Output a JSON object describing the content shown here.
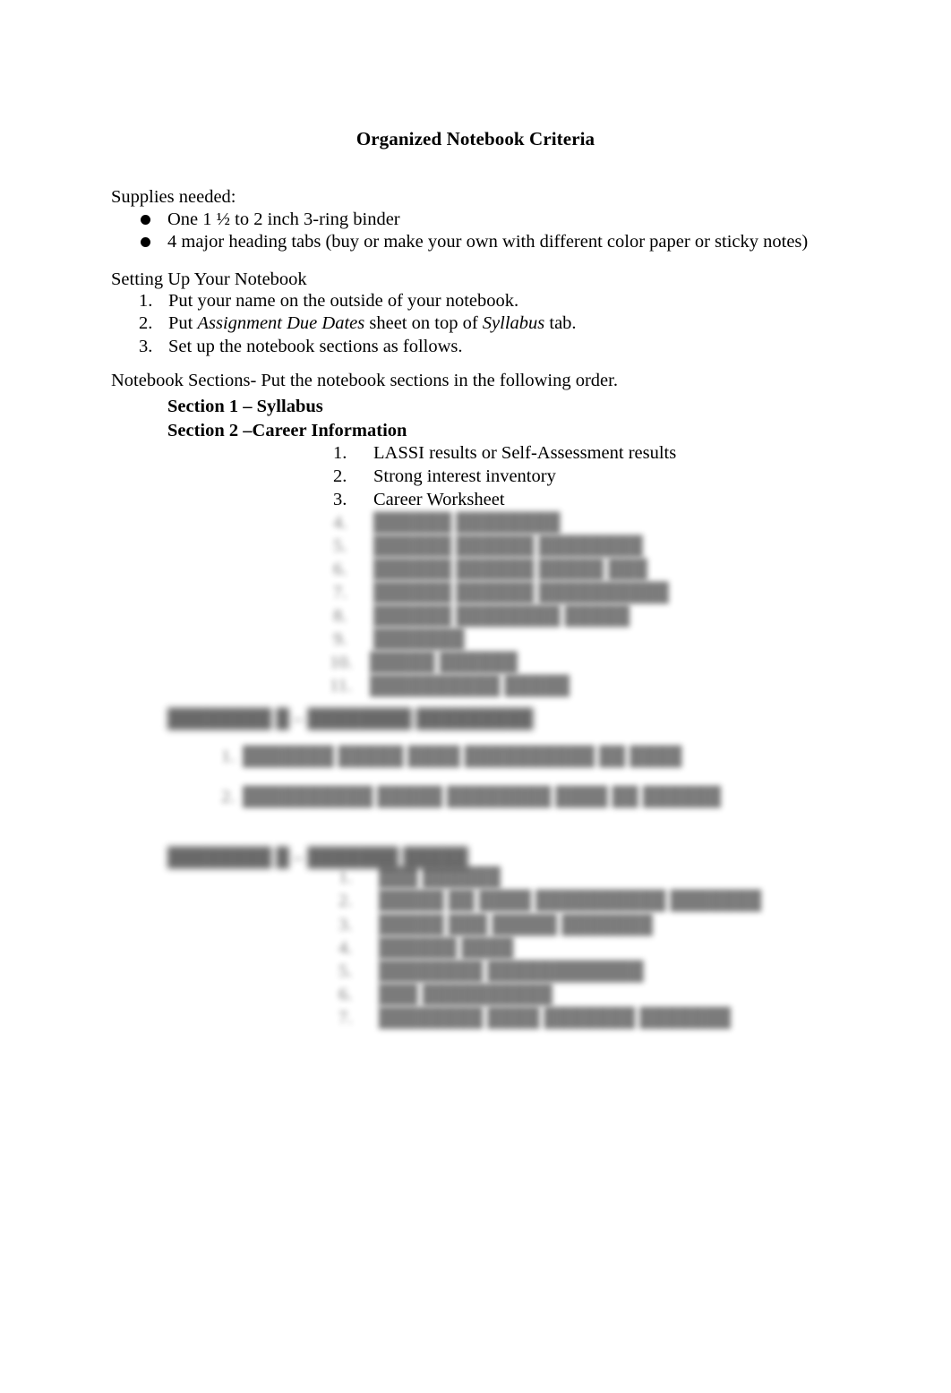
{
  "document": {
    "title": "Organized Notebook Criteria",
    "page_background": "#ffffff",
    "text_color": "#000000"
  },
  "supplies": {
    "heading": "Supplies needed:",
    "items": [
      "One 1 ½ to 2 inch 3-ring binder",
      "4 major heading tabs (buy or make your own with different color paper or sticky notes)"
    ]
  },
  "setting_up": {
    "heading": "Setting Up Your Notebook",
    "items": [
      {
        "number": "1.",
        "text": "Put your name on the outside of your notebook."
      },
      {
        "number": "2.",
        "text": "Put Assignment Due Dates sheet on top of Syllabus tab."
      },
      {
        "number": "3.",
        "text": "Set up the notebook sections as follows."
      }
    ]
  },
  "notebook_sections": {
    "heading": "Notebook Sections-   Put the notebook sections in the following order.",
    "section_1": {
      "heading": "Section 1 – Syllabus"
    },
    "section_2": {
      "heading": "Section 2 –Career Information",
      "items": [
        {
          "number": "1.",
          "text": "LASSI results or Self-Assessment results"
        },
        {
          "number": "2.",
          "text": "Strong interest inventory"
        },
        {
          "number": "3.",
          "text": "Career Worksheet"
        }
      ],
      "illegible_items": [
        {
          "number": "4.",
          "placeholder": "██████ ████████"
        },
        {
          "number": "5.",
          "placeholder": "██████ ██████ ████████"
        },
        {
          "number": "6.",
          "placeholder": "██████ ██████ █████ ███"
        },
        {
          "number": "7.",
          "placeholder": "██████ ██████ ██████████"
        },
        {
          "number": "8.",
          "placeholder": "██████ ████████ █████"
        },
        {
          "number": "9.",
          "placeholder": "███████"
        },
        {
          "number": "10.",
          "placeholder": "█████ ██████"
        },
        {
          "number": "11.",
          "placeholder": "██████████ █████"
        }
      ]
    },
    "section_3": {
      "heading_placeholder": "████████ █ – ████████ █████████",
      "illegible_items": [
        {
          "number": "1.",
          "placeholder": "███████ █████ ████ ██████████ ██ ████"
        },
        {
          "number": "2.",
          "placeholder": "██████████ █████ ████████ ████ ██ ██████"
        }
      ]
    },
    "section_4": {
      "heading_placeholder": "████████ █ – ███████ █████",
      "illegible_items": [
        {
          "number": "1.",
          "placeholder": "███ ██████"
        },
        {
          "number": "2.",
          "placeholder": "█████ ██ ████ ██████████ ███████"
        },
        {
          "number": "3.",
          "placeholder": "█████ ███ █████ ███████"
        },
        {
          "number": "4.",
          "placeholder": "██████ ████"
        },
        {
          "number": "5.",
          "placeholder": "████████ ████████████"
        },
        {
          "number": "6.",
          "placeholder": "███ ██████████"
        },
        {
          "number": "7.",
          "placeholder": "████████ ████ ███████ ███████"
        }
      ]
    }
  }
}
